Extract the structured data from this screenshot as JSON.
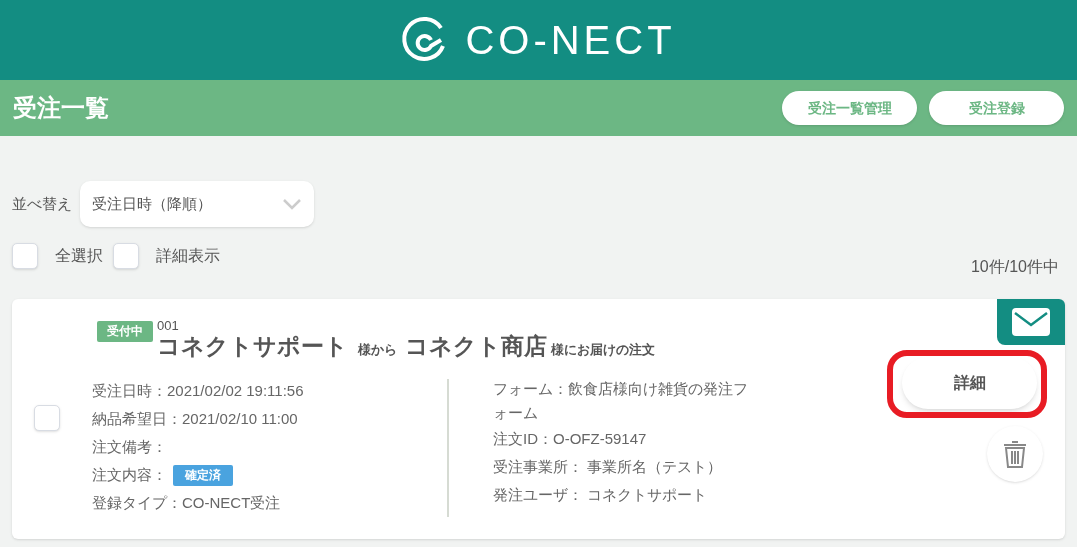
{
  "header": {
    "logo_text": "CO-NECT"
  },
  "title_bar": {
    "title": "受注一覧",
    "buttons": [
      "受注一覧管理",
      "受注登録"
    ]
  },
  "sort": {
    "label": "並べ替え",
    "value": "受注日時（降順）"
  },
  "options": [
    {
      "label": "全選択",
      "checked": false
    },
    {
      "label": "詳細表示",
      "checked": false
    }
  ],
  "count": "10件/10件中",
  "orders": [
    {
      "status": "受付中",
      "number": "001",
      "sender": "コネクトサポート",
      "sender_suffix": "様から",
      "recipient": "コネクト商店",
      "recipient_suffix": "様にお届けの注文",
      "checked": false,
      "highlighted": true,
      "left_fields": [
        {
          "text": "受注日時：2021/02/02 19:11:56"
        },
        {
          "text": "納品希望日：2021/02/10 11:00"
        },
        {
          "text": "注文備考："
        },
        {
          "text": "注文内容：",
          "badge": "確定済"
        },
        {
          "text": "登録タイプ：CO-NECT受注"
        }
      ],
      "right_fields": [
        {
          "text": "フォーム：飲食店様向け雑貨の発注フォーム"
        },
        {
          "text": "注文ID：O-OFZ-59147"
        },
        {
          "text": "受注事業所： 事業所名（テスト）"
        },
        {
          "text": "発注ユーザ： コネクトサポート"
        }
      ],
      "detail_button": "詳細"
    }
  ]
}
